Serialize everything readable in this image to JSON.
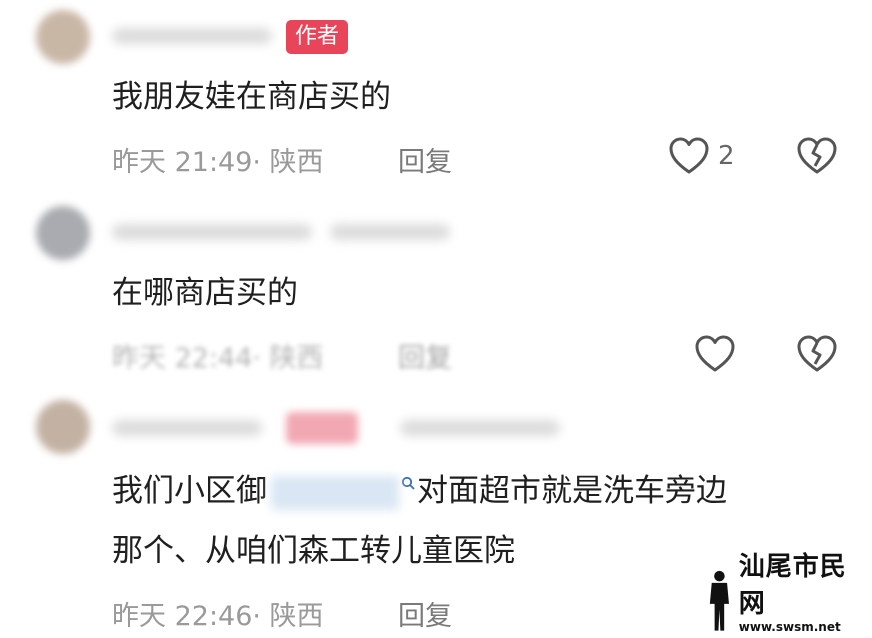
{
  "comments": [
    {
      "badge": "作者",
      "text": "我朋友娃在商店买的",
      "meta": "昨天 21:49· 陕西",
      "reply_label": "回复",
      "like_count": "2"
    },
    {
      "text": "在哪商店买的",
      "meta": "昨天 22:44· 陕西",
      "reply_label": "回复",
      "like_count": ""
    },
    {
      "text_before": "我们小区",
      "text_partial": "御",
      "text_after": "对面超市就是洗车旁边",
      "text_line2": "那个、从咱们森工转儿童医院",
      "meta": "昨天 22:46· 陕西",
      "reply_label": "回复"
    }
  ],
  "watermark": {
    "title": "汕尾市民网",
    "url": "www.swsm.net"
  },
  "icons": {
    "like": "heart-outline-icon",
    "dislike": "broken-heart-icon",
    "mention": "search-icon"
  },
  "colors": {
    "badge_bg": "#e8455a",
    "meta_text": "#9a9a9a",
    "main_text": "#1f1f1f"
  }
}
